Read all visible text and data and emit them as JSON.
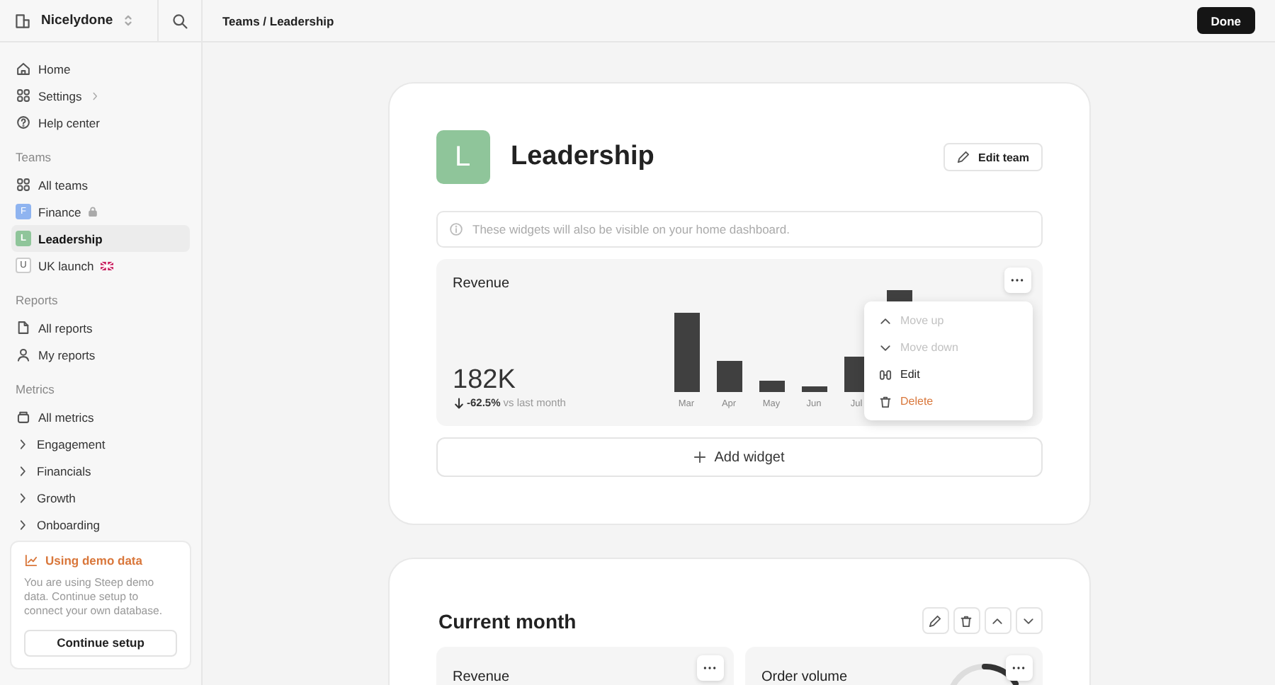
{
  "workspace": {
    "name": "Nicelydone"
  },
  "sidebar": {
    "sections": [
      {
        "items": [
          {
            "label": "Home",
            "kind": "link",
            "selected": false
          },
          {
            "label": "Settings",
            "kind": "link",
            "selected": false
          },
          {
            "label": "Help center",
            "kind": "link",
            "selected": false
          }
        ]
      },
      {
        "title": "Teams",
        "items": [
          {
            "label": "All teams",
            "kind": "link",
            "selected": false
          },
          {
            "label": "Finance",
            "kind": "team",
            "letter": "F",
            "color": "#8fb4f0",
            "selected": false
          },
          {
            "label": "Leadership",
            "kind": "team",
            "letter": "L",
            "color": "#8fc59a",
            "selected": true
          },
          {
            "label": "UK launch",
            "kind": "team",
            "letter": "U",
            "color": "#ffffff",
            "selected": false
          }
        ]
      },
      {
        "title": "Reports",
        "items": [
          {
            "label": "All reports",
            "kind": "link",
            "selected": false
          },
          {
            "label": "My reports",
            "kind": "link",
            "selected": false
          }
        ]
      },
      {
        "title": "Metrics",
        "items": [
          {
            "label": "All metrics",
            "kind": "link",
            "selected": false
          },
          {
            "label": "Engagement",
            "kind": "group",
            "selected": false
          },
          {
            "label": "Financials",
            "kind": "group",
            "selected": false
          },
          {
            "label": "Growth",
            "kind": "group",
            "selected": false
          },
          {
            "label": "Onboarding",
            "kind": "group",
            "selected": false
          }
        ]
      }
    ],
    "notice": {
      "title": "Using demo data",
      "text": "You are using Steep demo data. Continue setup to connect your own database.",
      "button": "Continue setup"
    }
  },
  "topbar": {
    "breadcrumb": "Teams / Leadership",
    "button": "Done"
  },
  "team": {
    "letter": "L",
    "name": "Leadership",
    "edit": "Edit team",
    "info": "These widgets will also be visible on your home dashboard.",
    "widget": {
      "title": "Revenue",
      "value": "182K",
      "change": "-62.5%",
      "change_note": "vs last month",
      "months": [
        "Mar",
        "Apr",
        "May",
        "Jun",
        "Jul"
      ]
    },
    "menu": [
      {
        "label": "Move up",
        "kind": "normal",
        "disabled": true
      },
      {
        "label": "Move down",
        "kind": "normal",
        "disabled": true
      },
      {
        "label": "Edit",
        "kind": "normal",
        "disabled": false
      },
      {
        "label": "Delete",
        "kind": "danger",
        "disabled": false
      }
    ],
    "add": "Add widget"
  },
  "section": {
    "title": "Current month",
    "widgets": [
      {
        "title": "Revenue"
      },
      {
        "title": "Order volume"
      }
    ]
  }
}
